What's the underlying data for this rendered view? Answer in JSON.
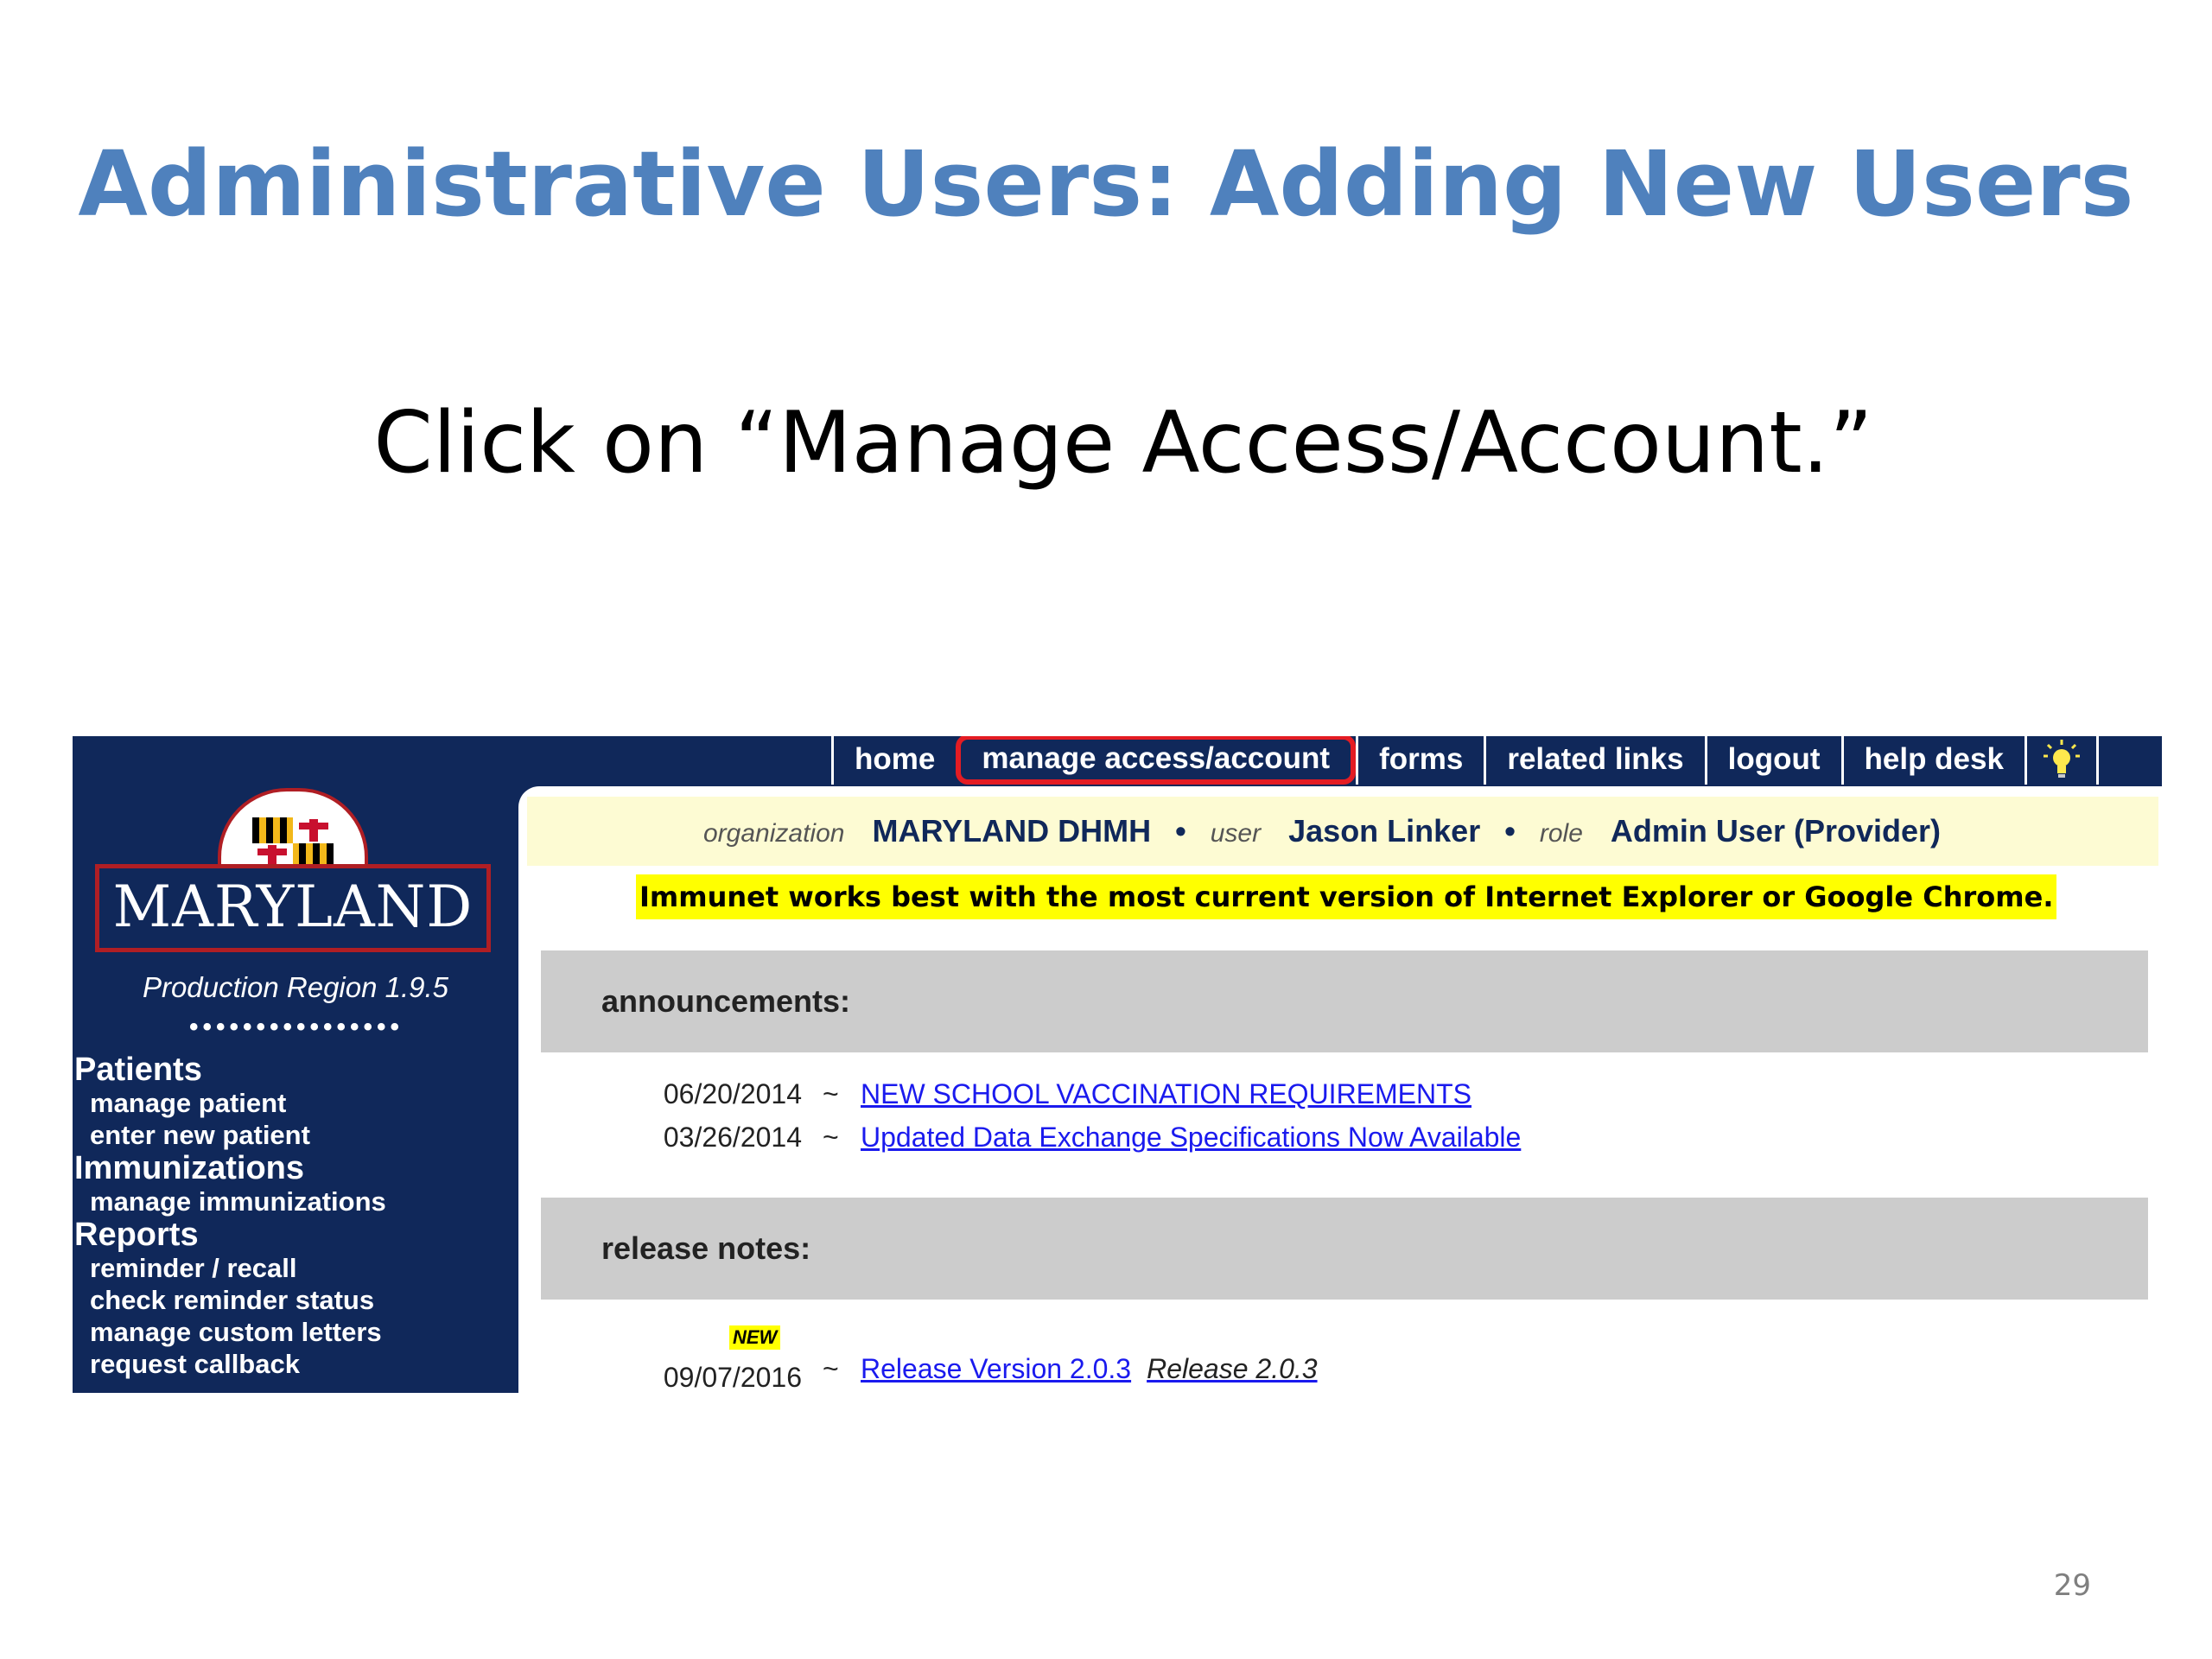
{
  "slide": {
    "title": "Administrative Users: Adding New Users",
    "instruction": "Click on “Manage Access/Account.”",
    "page_number": "29"
  },
  "nav": {
    "tabs": [
      "home",
      "manage access/account",
      "forms",
      "related links",
      "logout",
      "help desk"
    ],
    "tip_icon": "lightbulb-icon"
  },
  "sidebar": {
    "logo_text": "MARYLAND",
    "region": "Production Region 1.9.5",
    "dots": "••••••••••••••••",
    "sections": [
      {
        "title": "Patients",
        "items": [
          "manage patient",
          "enter new patient"
        ]
      },
      {
        "title": "Immunizations",
        "items": [
          "manage immunizations"
        ]
      },
      {
        "title": "Reports",
        "items": [
          "reminder / recall",
          "check reminder status",
          "manage custom letters",
          "request callback"
        ]
      }
    ]
  },
  "user_bar": {
    "organization_label": "organization",
    "organization": "MARYLAND DHMH",
    "user_label": "user",
    "user": "Jason Linker",
    "role_label": "role",
    "role": "Admin User (Provider)",
    "bullet": "•"
  },
  "browser_note": "Immunet works best with the most current version of Internet Explorer or Google Chrome.",
  "announcements": {
    "heading": "announcements:",
    "items": [
      {
        "date": "06/20/2014",
        "sep": "~",
        "title": "NEW SCHOOL VACCINATION REQUIREMENTS"
      },
      {
        "date": "03/26/2014",
        "sep": "~",
        "title": "Updated Data Exchange Specifications Now Available"
      }
    ]
  },
  "release_notes": {
    "heading": "release notes:",
    "items": [
      {
        "badge": "NEW",
        "date": "09/07/2016",
        "sep": "~",
        "title": "Release Version 2.0.3",
        "description": "Release 2.0.3"
      }
    ]
  },
  "colors": {
    "title_blue": "#4f81bd",
    "navy": "#10285a",
    "highlight_red": "#e41c23",
    "note_yellow": "#ffff00",
    "link_blue": "#1a1aee"
  }
}
